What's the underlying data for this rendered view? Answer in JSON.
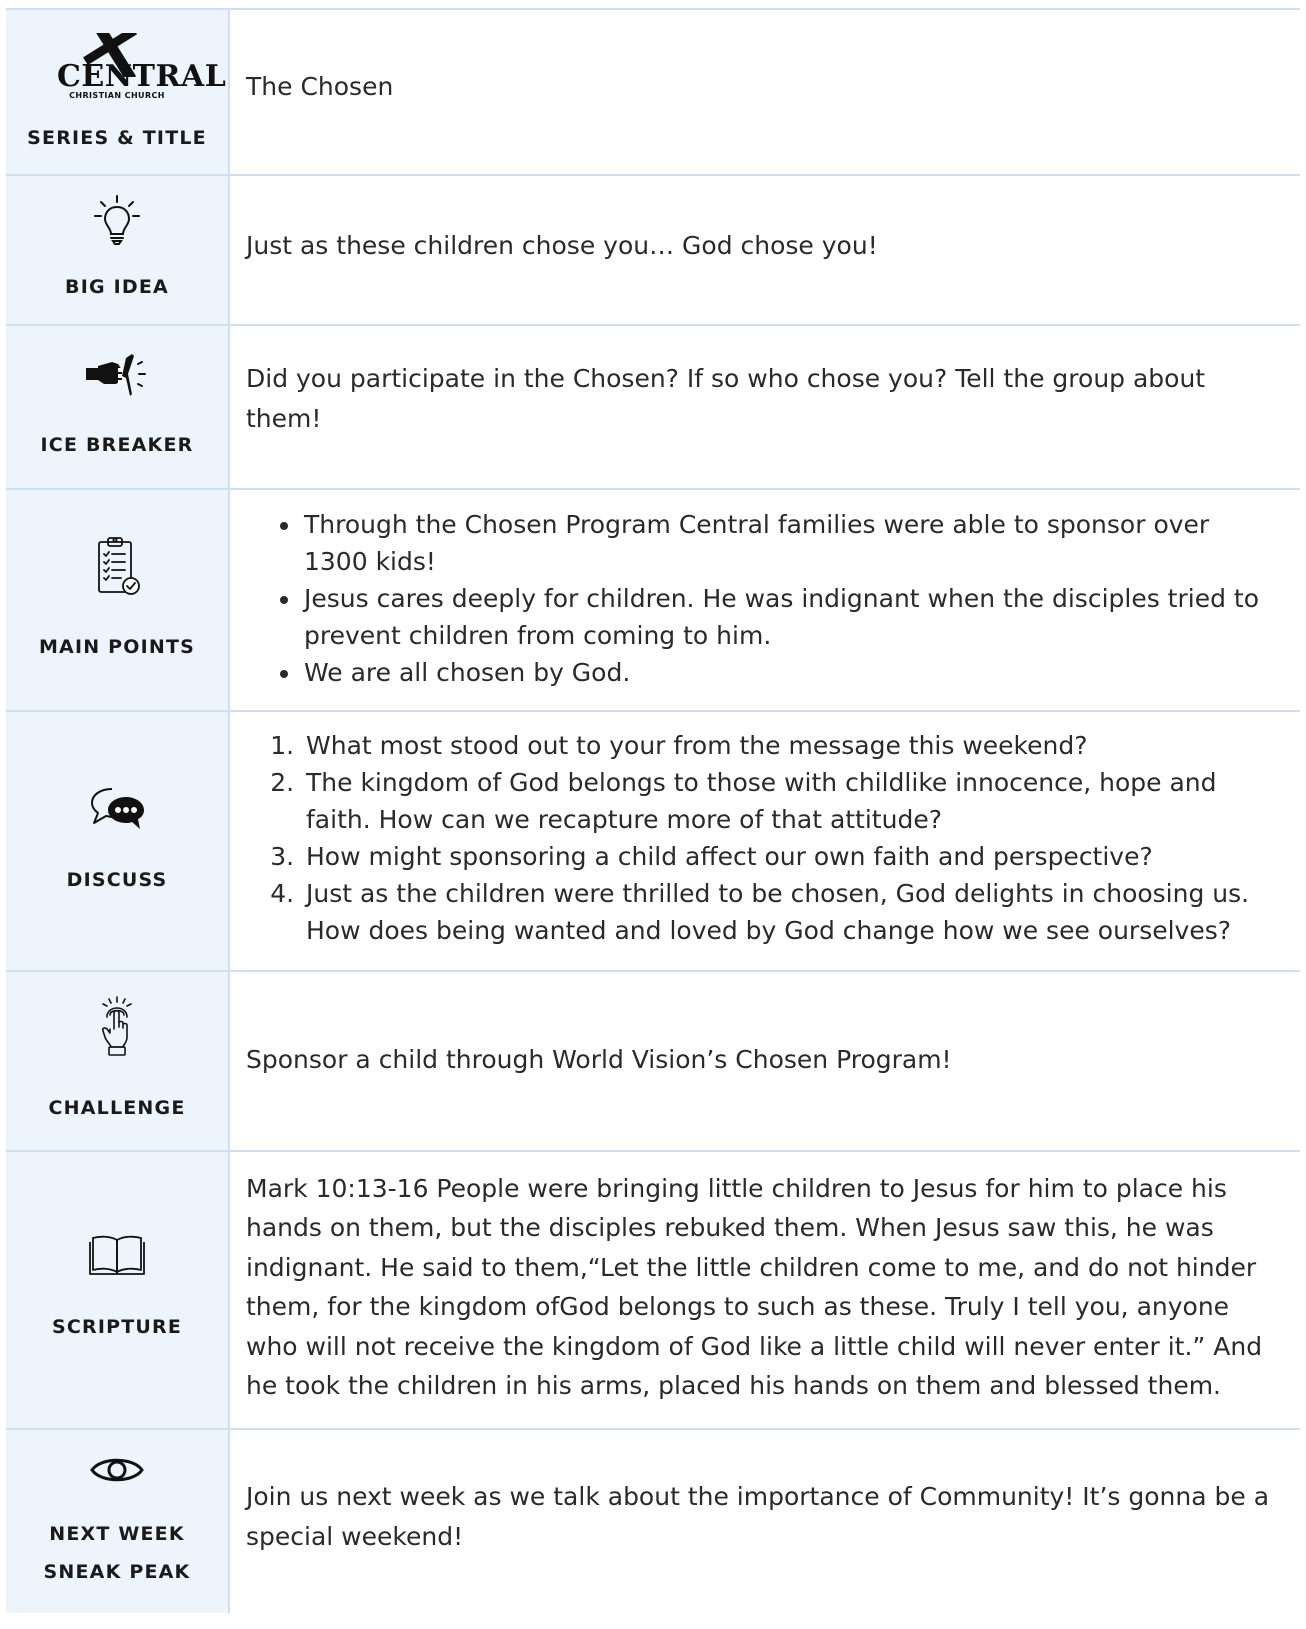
{
  "logo": {
    "word": "CENTRAL",
    "sub": "CHRISTIAN CHURCH"
  },
  "sections": {
    "series": {
      "label": "SERIES & TITLE",
      "content": "The Chosen"
    },
    "big_idea": {
      "label": "BIG IDEA",
      "content": "Just as these children chose you… God chose you!",
      "icon": "lightbulb-icon"
    },
    "ice_breaker": {
      "label": "ICE BREAKER",
      "content": "Did you participate in the Chosen? If so who chose you? Tell the group about them!",
      "icon": "fist-bump-icon"
    },
    "main_points": {
      "label": "MAIN POINTS",
      "icon": "clipboard-checklist-icon",
      "items": [
        "Through the Chosen Program Central families were able to sponsor over 1300 kids!",
        "Jesus cares deeply for children. He was indignant when the disciples tried to prevent children from coming to him.",
        "We are all chosen by God."
      ]
    },
    "discuss": {
      "label": "DISCUSS",
      "icon": "chat-bubbles-icon",
      "items": [
        "What most stood out to your from the message this weekend?",
        "The kingdom of God belongs to those with childlike innocence, hope and faith. How can we recapture more of that attitude?",
        "How might sponsoring a child affect our own faith and perspective?",
        "Just as the children were thrilled to be chosen, God delights in choosing us. How does being wanted and loved by God change how we see ourselves?"
      ]
    },
    "challenge": {
      "label": "CHALLENGE",
      "content": "Sponsor a child through World Vision’s Chosen Program!",
      "icon": "pointing-hand-icon"
    },
    "scripture": {
      "label": "SCRIPTURE",
      "icon": "open-book-icon",
      "content": "Mark 10:13-16 People were bringing little children to Jesus for him to place his hands on them, but the disciples rebuked them. When Jesus saw this, he was indignant. He said to them,“Let the little children come to me, and do not hinder them, for the kingdom ofGod belongs to such as these. Truly I tell you, anyone who will not receive the kingdom of God like a little child will never enter it.” And he took the children in his arms, placed his hands on them and blessed them."
    },
    "next_week": {
      "label_line1": "NEXT WEEK",
      "label_line2": "SNEAK PEAK",
      "icon": "eye-icon",
      "content": "Join us next week as we talk about the importance of Community! It’s gonna be a special weekend!"
    }
  }
}
